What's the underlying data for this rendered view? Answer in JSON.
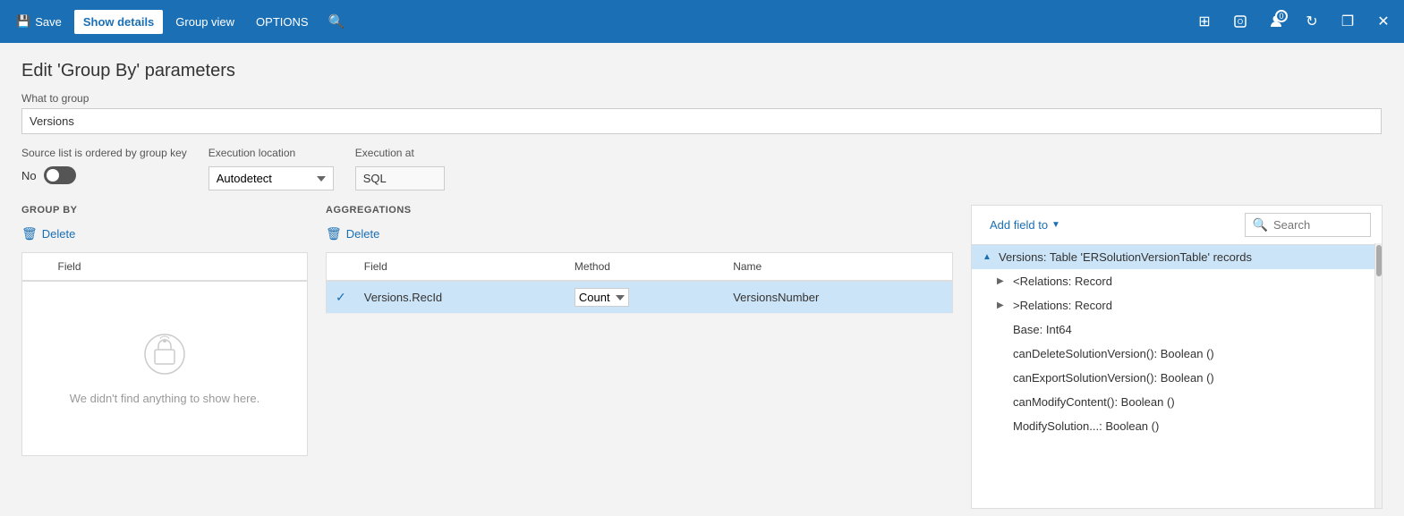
{
  "titlebar": {
    "save_label": "Save",
    "show_details_label": "Show details",
    "group_view_label": "Group view",
    "options_label": "OPTIONS",
    "icons": {
      "grid": "⊞",
      "office": "🅾",
      "user": "👤",
      "refresh": "↻",
      "restore": "❐",
      "close": "✕"
    },
    "badge_count": "0"
  },
  "page": {
    "title": "Edit 'Group By' parameters",
    "what_to_group_label": "What to group",
    "what_to_group_value": "Versions",
    "source_ordered_label": "Source list is ordered by group key",
    "no_label": "No",
    "execution_location_label": "Execution location",
    "execution_location_value": "Autodetect",
    "execution_at_label": "Execution at",
    "execution_at_value": "SQL"
  },
  "group_by": {
    "section_title": "GROUP BY",
    "delete_label": "Delete",
    "field_header": "Field",
    "empty_message": "We didn't find anything to show here."
  },
  "aggregations": {
    "section_title": "AGGREGATIONS",
    "delete_label": "Delete",
    "field_header": "Field",
    "method_header": "Method",
    "name_header": "Name",
    "rows": [
      {
        "checked": true,
        "field": "Versions.RecId",
        "method": "Count",
        "name": "VersionsNumber"
      }
    ]
  },
  "right_panel": {
    "add_field_label": "Add field to",
    "search_placeholder": "Search",
    "tree_items": [
      {
        "level": 0,
        "arrow": "▲",
        "label": "Versions: Table 'ERSolutionVersionTable' records",
        "selected": true
      },
      {
        "level": 1,
        "arrow": "▶",
        "label": "<Relations: Record",
        "selected": false
      },
      {
        "level": 1,
        "arrow": "▶",
        "label": ">Relations: Record",
        "selected": false
      },
      {
        "level": 1,
        "arrow": "",
        "label": "Base: Int64",
        "selected": false
      },
      {
        "level": 1,
        "arrow": "",
        "label": "canDeleteSolutionVersion(): Boolean ()",
        "selected": false
      },
      {
        "level": 1,
        "arrow": "",
        "label": "canExportSolutionVersion(): Boolean ()",
        "selected": false
      },
      {
        "level": 1,
        "arrow": "",
        "label": "canModifyContent(): Boolean ()",
        "selected": false
      },
      {
        "level": 1,
        "arrow": "",
        "label": "ModifySolution...",
        "selected": false
      }
    ]
  }
}
